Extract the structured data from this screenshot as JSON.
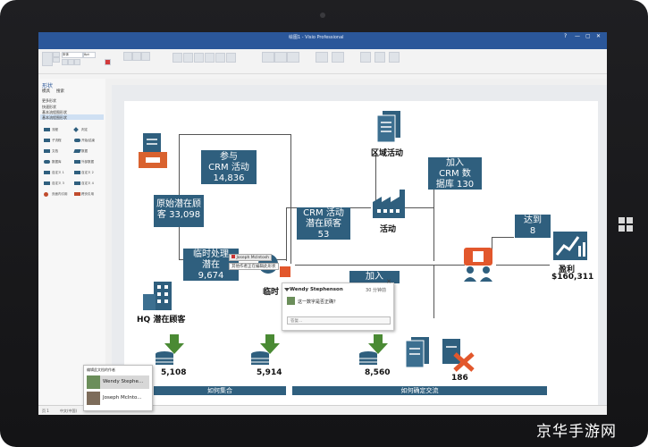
{
  "window": {
    "title": "绘图1 - Visio Professional",
    "controls": [
      "?",
      "—",
      "▢",
      "✕"
    ]
  },
  "ribbon": {
    "font_name": "宋体",
    "font_size": "8pt"
  },
  "sidebar": {
    "title": "形状",
    "tabs": [
      "模具",
      "搜索"
    ],
    "items": [
      "更多形状",
      "快速形状",
      "基本流程图形状",
      "基本流程图形状"
    ],
    "shapes": [
      "流程",
      "判定",
      "子流程",
      "开始/结束",
      "文档",
      "数据",
      "数据库",
      "外部数据",
      "自定义 1",
      "自定义 2",
      "自定义 3",
      "自定义 4",
      "页面内引用",
      "跨页引用"
    ]
  },
  "diagram": {
    "boxes": [
      {
        "text1": "参与",
        "text2": "CRM 活动",
        "text3": "14,836"
      },
      {
        "text1": "原始潜在顾",
        "text2": "客 33,098"
      },
      {
        "text1": "临时处理",
        "text2": "潜在",
        "text3": "9,674"
      },
      {
        "text1": "CRM 活动",
        "text2": "潜在顾客",
        "text3": "53"
      },
      {
        "text1": "加入",
        "text2": "CRM 数",
        "text3": "据库 130"
      },
      {
        "text1": "达到",
        "text2": "8"
      },
      {
        "text1": "加入"
      }
    ],
    "labels": {
      "region": "区域活动",
      "activity": "活动",
      "hq": "HQ 潜在顾客",
      "profit": "盈利",
      "profit_value": "$160,311",
      "temp": "临时"
    },
    "numbers": [
      "5,108",
      "5,914",
      "8,560",
      "186"
    ],
    "banners": [
      "如何集合",
      "如何确定交流"
    ]
  },
  "comment": {
    "author": "Wendy Stephenson",
    "date": "30 分钟前",
    "text": "这一数字是否正确？",
    "reply_placeholder": "答复..."
  },
  "tags": {
    "joseph": "Joseph McIntosh",
    "editing": "其他作者正在编辑此形状"
  },
  "presence": {
    "header": "编辑此文档的作者",
    "users": [
      "Wendy Stephe...",
      "Joseph McInto..."
    ]
  },
  "statusbar": {
    "page": "页 1",
    "lang": "中文(中国)"
  },
  "watermark": "京华手游网"
}
